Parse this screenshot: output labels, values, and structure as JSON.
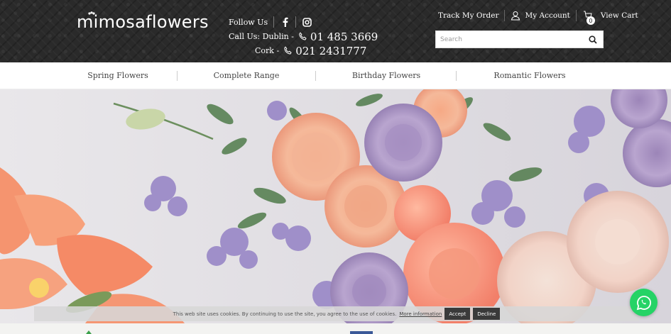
{
  "header": {
    "logo_text": "mimosaflowers",
    "follow_label": "Follow Us",
    "social": [
      "facebook-icon",
      "instagram-icon"
    ],
    "call": {
      "dublin_label": "Call Us: Dublin -",
      "dublin_number": "01 485 3669",
      "cork_label": "Cork -",
      "cork_number": "021 2431777"
    },
    "links": {
      "track": "Track My Order",
      "account": "My Account",
      "cart": "View Cart",
      "cart_count": "0"
    },
    "search": {
      "placeholder": "Search"
    }
  },
  "nav": {
    "items": [
      {
        "label": "Spring Flowers"
      },
      {
        "label": "Complete Range"
      },
      {
        "label": "Birthday Flowers"
      },
      {
        "label": "Romantic Flowers"
      }
    ]
  },
  "cookie": {
    "text": "This web site uses cookies. By continuing to use the site, you agree to the use of cookies.",
    "more": "More information",
    "accept": "Accept",
    "decline": "Decline"
  },
  "colors": {
    "header_bg": "#2a2a2a",
    "whatsapp": "#25d366",
    "button_dark": "#3a3a3a"
  }
}
